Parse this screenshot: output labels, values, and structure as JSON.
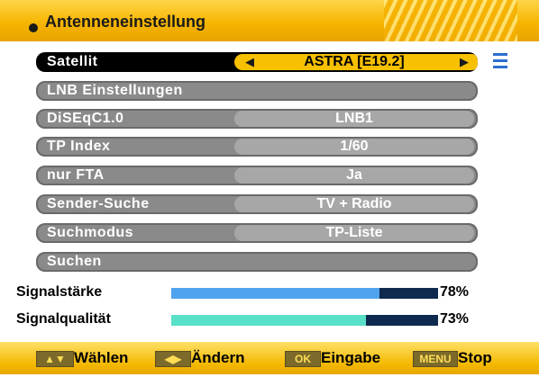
{
  "header": {
    "title": "Antenneneinstellung"
  },
  "rows": [
    {
      "label": "Satellit",
      "value": "ASTRA [E19.2]"
    },
    {
      "label": "LNB Einstellungen",
      "value": ""
    },
    {
      "label": "DiSEqC1.0",
      "value": "LNB1"
    },
    {
      "label": "TP Index",
      "value": "1/60"
    },
    {
      "label": "nur FTA",
      "value": "Ja"
    },
    {
      "label": "Sender-Suche",
      "value": "TV + Radio"
    },
    {
      "label": "Suchmodus",
      "value": "TP-Liste"
    },
    {
      "label": "Suchen",
      "value": ""
    }
  ],
  "signal": {
    "strength": {
      "label": "Signalstärke",
      "value": "78%",
      "percent": 78,
      "color": "#4fa3ef"
    },
    "quality": {
      "label": "Signalqualität",
      "value": "73%",
      "percent": 73,
      "color": "#59e0c8"
    }
  },
  "footer": {
    "items": [
      {
        "glyph": "▲▼",
        "label": "Wählen"
      },
      {
        "glyph": "◀▶",
        "label": "Ändern"
      },
      {
        "glyph": "OK",
        "label": "Eingabe"
      },
      {
        "glyph": "MENU",
        "label": "Stop"
      }
    ]
  },
  "colors": {
    "accent": "#f7c000",
    "row": "#8a8a8a",
    "selected": "#000000"
  }
}
